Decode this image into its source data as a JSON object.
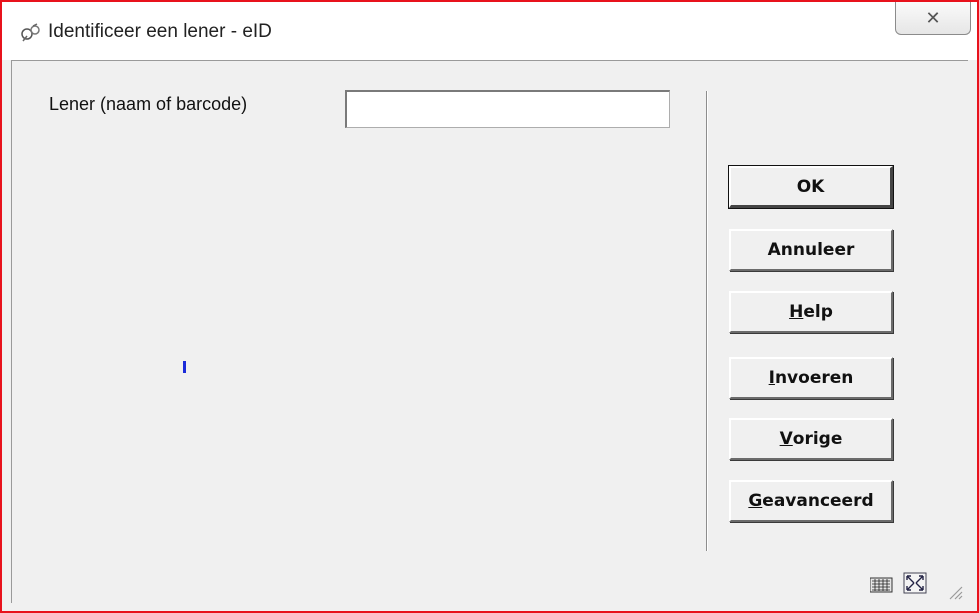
{
  "window": {
    "title": "Identificeer een lener - eID",
    "close_label": "✕"
  },
  "form": {
    "lener_label": "Lener (naam of barcode)",
    "lener_value": "",
    "lener_placeholder": ""
  },
  "buttons": {
    "ok": "OK",
    "annuleer": "Annuleer",
    "help_u": "H",
    "help_rest": "elp",
    "invoeren_u": "I",
    "invoeren_rest": "nvoeren",
    "vorige_u": "V",
    "vorige_rest": "orige",
    "geavanceerd_u": "G",
    "geavanceerd_rest": "eavanceerd"
  },
  "colors": {
    "frame": "#e8121c",
    "caret": "#1b2bd9"
  },
  "icons": [
    "app-icon",
    "close-icon",
    "keyboard-icon",
    "maximize-icon",
    "resize-grip-icon"
  ]
}
